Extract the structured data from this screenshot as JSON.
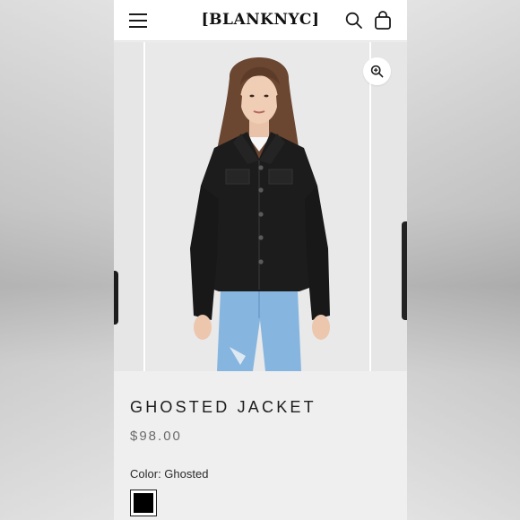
{
  "header": {
    "logo": "[BLANKNYC]",
    "menu_icon": "hamburger-menu-icon",
    "search_icon": "search-icon",
    "cart_icon": "shopping-bag-icon"
  },
  "gallery": {
    "zoom_icon": "zoom-in-icon",
    "image_description_icon": "product-photo"
  },
  "product": {
    "title": "GHOSTED JACKET",
    "price": "$98.00",
    "color_label": "Color: Ghosted",
    "swatches": [
      {
        "name": "Ghosted",
        "color": "#000000",
        "selected": true
      }
    ]
  },
  "colors": {
    "jacket": "#1a1a1a",
    "jeans": "#7fb0dd",
    "background": "#efefef",
    "accent": "#111111"
  }
}
